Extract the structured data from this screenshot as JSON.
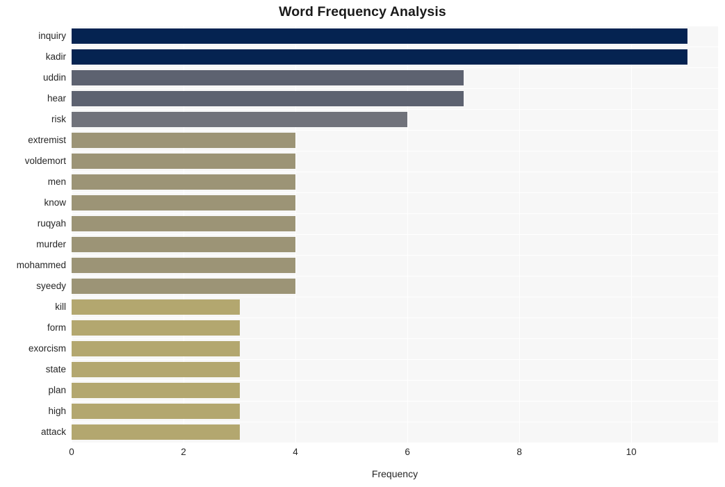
{
  "chart_data": {
    "type": "bar",
    "orientation": "horizontal",
    "title": "Word Frequency Analysis",
    "xlabel": "Frequency",
    "ylabel": "",
    "xlim": [
      0,
      11.55
    ],
    "xticks": [
      0,
      2,
      4,
      6,
      8,
      10
    ],
    "grid": true,
    "legend": null,
    "categories": [
      "inquiry",
      "kadir",
      "uddin",
      "hear",
      "risk",
      "extremist",
      "voldemort",
      "men",
      "know",
      "ruqyah",
      "murder",
      "mohammed",
      "syeedy",
      "kill",
      "form",
      "exorcism",
      "state",
      "plan",
      "high",
      "attack"
    ],
    "values": [
      11,
      11,
      7,
      7,
      6,
      4,
      4,
      4,
      4,
      4,
      4,
      4,
      4,
      3,
      3,
      3,
      3,
      3,
      3,
      3
    ],
    "bar_colors": [
      "#052351",
      "#052351",
      "#5d6270",
      "#5d6270",
      "#70727a",
      "#9c9476",
      "#9c9476",
      "#9c9476",
      "#9c9476",
      "#9c9476",
      "#9c9476",
      "#9c9476",
      "#9c9476",
      "#b3a76f",
      "#b3a76f",
      "#b3a76f",
      "#b3a76f",
      "#b3a76f",
      "#b3a76f",
      "#b3a76f"
    ]
  },
  "style": {
    "plot_background": "#f7f7f7",
    "figure_background": "#ffffff",
    "gridline_color": "#ffffff",
    "text_color": "#262626"
  }
}
